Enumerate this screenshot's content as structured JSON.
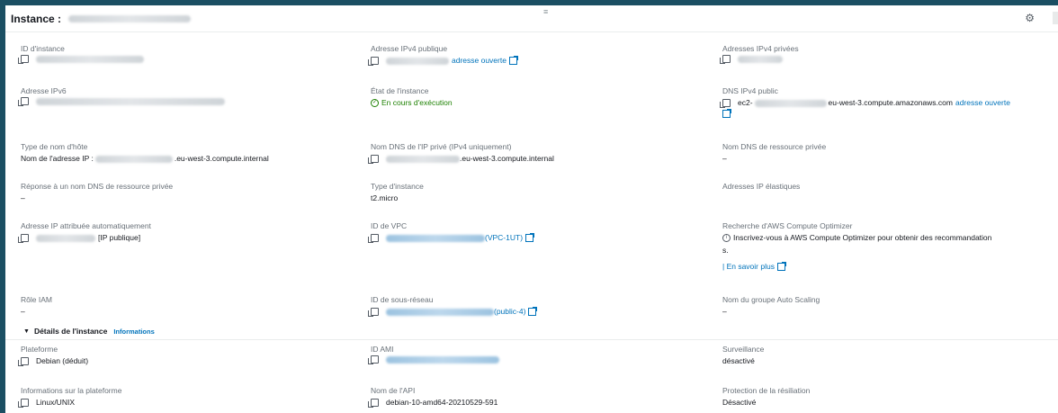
{
  "header": {
    "title": "Instance :",
    "drag_handle": "≡",
    "settings_icon": "gear-icon"
  },
  "fields": {
    "instance_id": {
      "label": "ID d'instance"
    },
    "public_ipv4": {
      "label": "Adresse IPv4 publique",
      "link": "adresse ouverte"
    },
    "private_ipv4": {
      "label": "Adresses IPv4 privées"
    },
    "ipv6": {
      "label": "Adresse IPv6"
    },
    "instance_state": {
      "label": "État de l'instance",
      "value": "En cours d'exécution"
    },
    "public_dns": {
      "label": "DNS IPv4 public",
      "prefix": "ec2-",
      "value": "eu-west-3.compute.amazonaws.com",
      "link": "adresse ouverte"
    },
    "hostname_type": {
      "label": "Type de nom d'hôte",
      "prefix": "Nom de l'adresse IP :",
      "value": ".eu-west-3.compute.internal"
    },
    "private_dns_ipv4": {
      "label": "Nom DNS de l'IP privé (IPv4 uniquement)",
      "value": ".eu-west-3.compute.internal"
    },
    "private_resource_dns": {
      "label": "Nom DNS de ressource privée",
      "value": "–"
    },
    "private_resource_dns_answer": {
      "label": "Réponse à un nom DNS de ressource privée",
      "value": "–"
    },
    "instance_type": {
      "label": "Type d'instance",
      "value": "t2.micro"
    },
    "elastic_ip": {
      "label": "Adresses IP élastiques"
    },
    "auto_ip": {
      "label": "Adresse IP attribuée automatiquement",
      "value": "[IP publique]"
    },
    "vpc_id": {
      "label": "ID de VPC",
      "value": "(VPC-1UT)"
    },
    "optimizer": {
      "label": "Recherche d'AWS Compute Optimizer",
      "value": "Inscrivez-vous à AWS Compute Optimizer pour obtenir des recommandation",
      "value2": "s.",
      "link": "| En savoir plus"
    },
    "iam_role": {
      "label": "Rôle IAM",
      "value": "–"
    },
    "subnet_id": {
      "label": "ID de sous-réseau",
      "value": "(public-4)"
    },
    "asg_name": {
      "label": "Nom du groupe Auto Scaling",
      "value": "–"
    }
  },
  "details": {
    "title": "Détails de l'instance",
    "info": "Informations",
    "platform": {
      "label": "Plateforme",
      "value": "Debian (déduit)"
    },
    "ami_id": {
      "label": "ID AMI"
    },
    "monitoring": {
      "label": "Surveillance",
      "value": "désactivé"
    },
    "platform_info": {
      "label": "Informations sur la plateforme",
      "value": "Linux/UNIX"
    },
    "ami_name": {
      "label": "Nom de l'API",
      "value": "debian-10-amd64-20210529-591"
    },
    "termination": {
      "label": "Protection de la résiliation",
      "value": "Désactivé"
    }
  },
  "colors": {
    "link": "#0073bb",
    "success": "#1d8102",
    "label": "#687078",
    "frame": "#1b4f63"
  }
}
